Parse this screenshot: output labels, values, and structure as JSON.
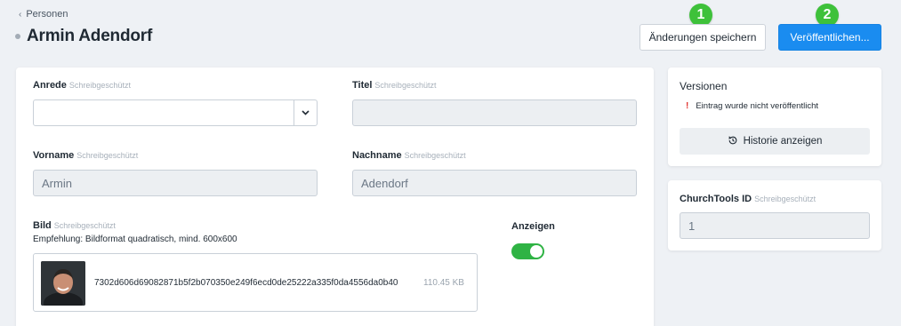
{
  "header": {
    "back_label": "Personen",
    "title": "Armin Adendorf",
    "save_label": "Änderungen speichern",
    "publish_label": "Veröffentlichen...",
    "badge_1": "1",
    "badge_2": "2"
  },
  "form": {
    "readonly_label": "Schreibgeschützt",
    "anrede": {
      "label": "Anrede",
      "value": ""
    },
    "titel": {
      "label": "Titel",
      "value": ""
    },
    "vorname": {
      "label": "Vorname",
      "value": "Armin"
    },
    "nachname": {
      "label": "Nachname",
      "value": "Adendorf"
    },
    "bild": {
      "label": "Bild",
      "hint": "Empfehlung: Bildformat quadratisch, mind. 600x600",
      "file_name": "7302d606d69082871b5f2b070350e249f6ecd0de25222a335f0da4556da0b40",
      "file_size": "110.45 KB"
    },
    "anzeigen": {
      "label": "Anzeigen",
      "checked": true
    }
  },
  "versions": {
    "title": "Versionen",
    "warning": "Eintrag wurde nicht veröffentlicht",
    "history_label": "Historie anzeigen"
  },
  "churchtools": {
    "label": "ChurchTools ID",
    "value": "1"
  },
  "colors": {
    "primary": "#1a8cf0",
    "toggle_on": "#2fb344",
    "badge": "#3ec13a",
    "warning": "#e0332f"
  }
}
